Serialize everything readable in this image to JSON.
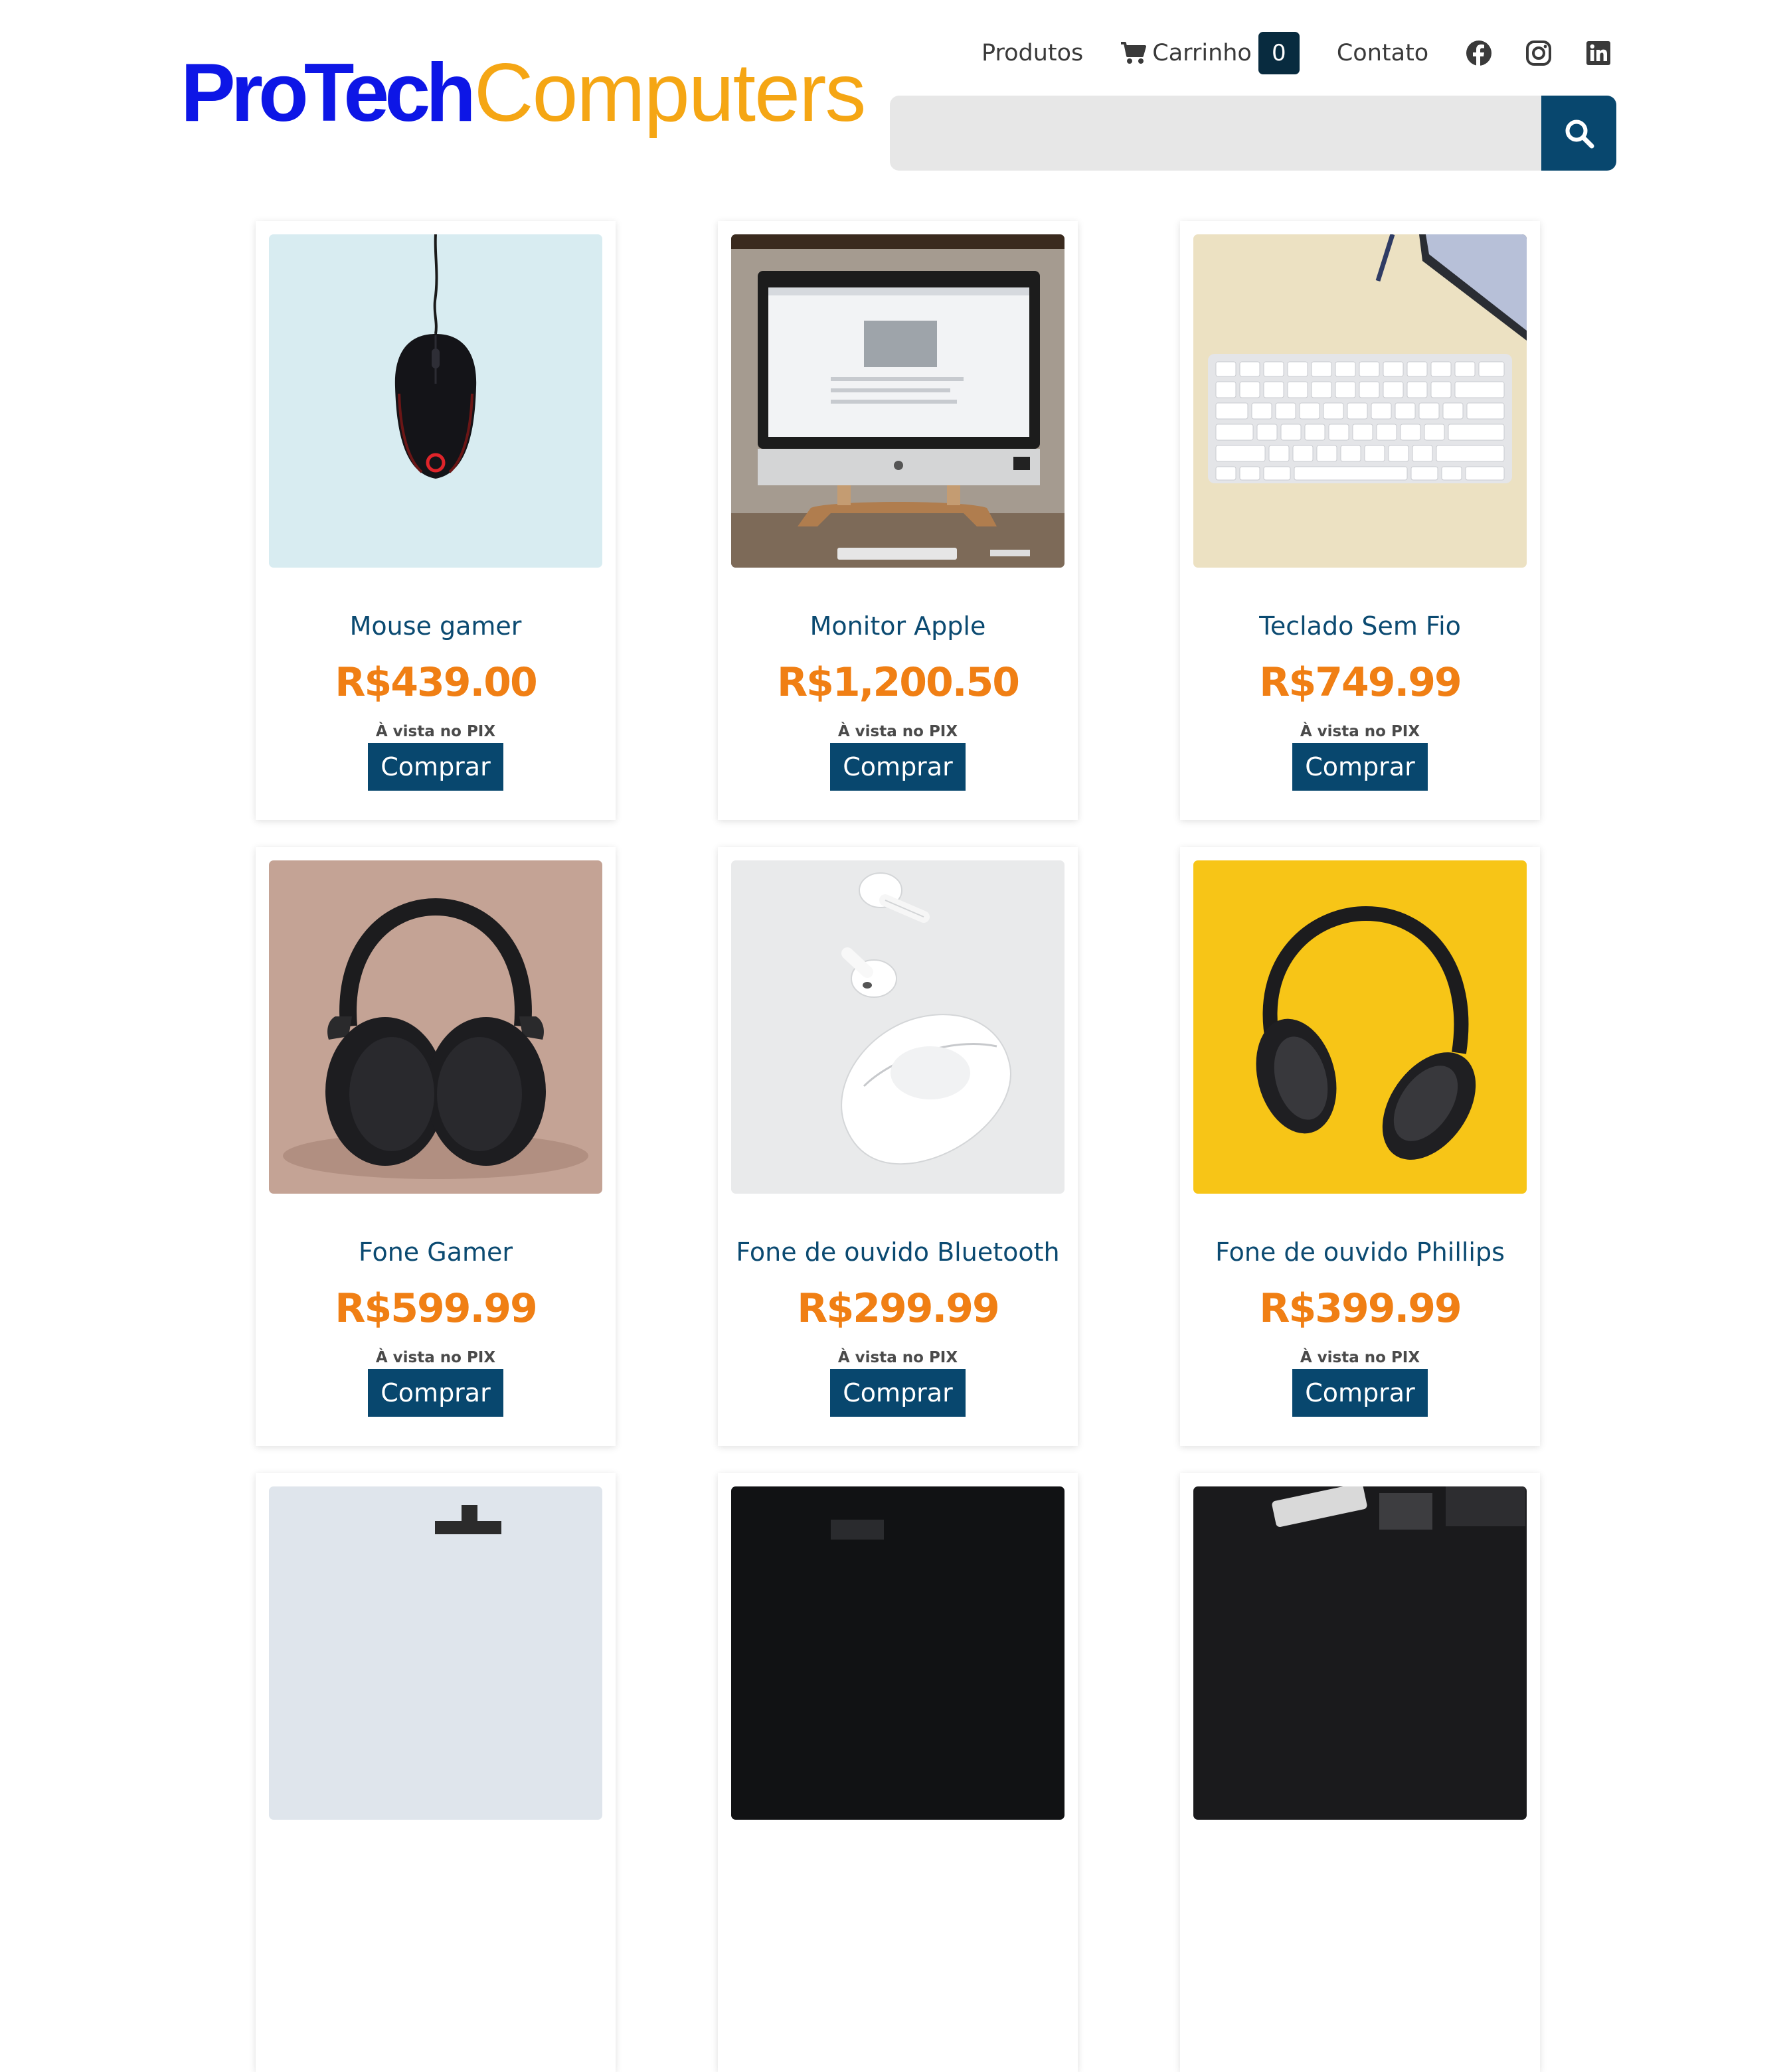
{
  "header": {
    "logo_part1": "ProTech",
    "logo_part2": "Computers",
    "nav": {
      "produtos": "Produtos",
      "carrinho": "Carrinho",
      "cart_count": "0",
      "contato": "Contato"
    },
    "social_icons": [
      "facebook-icon",
      "instagram-icon",
      "linkedin-icon"
    ],
    "search": {
      "placeholder": "",
      "value": ""
    }
  },
  "colors": {
    "logo_blue": "#0d16e6",
    "logo_orange": "#f5a614",
    "primary_dark_blue": "#08476e",
    "price_orange": "#f07f14"
  },
  "products": [
    {
      "name": "Mouse gamer",
      "price": "R$439.00",
      "payment": "À vista no PIX",
      "button": "Comprar"
    },
    {
      "name": "Monitor Apple",
      "price": "R$1,200.50",
      "payment": "À vista no PIX",
      "button": "Comprar"
    },
    {
      "name": "Teclado Sem Fio",
      "price": "R$749.99",
      "payment": "À vista no PIX",
      "button": "Comprar"
    },
    {
      "name": "Fone Gamer",
      "price": "R$599.99",
      "payment": "À vista no PIX",
      "button": "Comprar"
    },
    {
      "name": "Fone de ouvido Bluetooth",
      "price": "R$299.99",
      "payment": "À vista no PIX",
      "button": "Comprar"
    },
    {
      "name": "Fone de ouvido Phillips",
      "price": "R$399.99",
      "payment": "À vista no PIX",
      "button": "Comprar"
    }
  ]
}
